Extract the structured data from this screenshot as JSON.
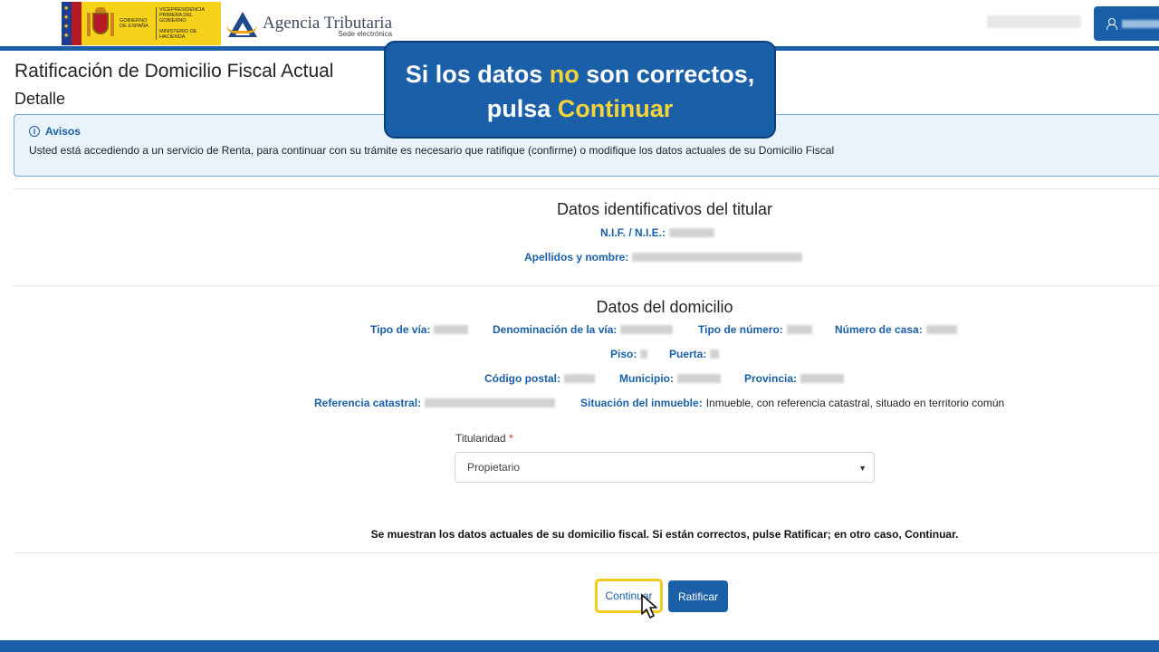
{
  "header": {
    "gov_logo": {
      "line1": "GOBIERNO DE ESPAÑA",
      "line2": "VICEPRESIDENCIA PRIMERA DEL GOBIERNO",
      "line3": "MINISTERIO DE HACIENDA"
    },
    "brand_title": "Agencia Tributaria",
    "brand_sub": "Sede electrónica"
  },
  "page": {
    "title": "Ratificación de Domicilio Fiscal Actual",
    "subtitle": "Detalle"
  },
  "alert": {
    "icon": "info-icon",
    "title": "Avisos",
    "text": "Usted está accediendo a un servicio de Renta, para continuar con su trámite es necesario que ratifique (confirme) o modifique los datos actuales de su Domicilio Fiscal"
  },
  "titular": {
    "section_title": "Datos identificativos del titular",
    "nif_label": "N.I.F. / N.I.E.:",
    "nombre_label": "Apellidos y nombre:"
  },
  "domicilio": {
    "section_title": "Datos del domicilio",
    "tipo_via_label": "Tipo de vía:",
    "denominacion_label": "Denominación de la vía:",
    "tipo_numero_label": "Tipo de número:",
    "numero_casa_label": "Número de casa:",
    "piso_label": "Piso:",
    "puerta_label": "Puerta:",
    "cp_label": "Código postal:",
    "municipio_label": "Municipio:",
    "provincia_label": "Provincia:",
    "ref_catastral_label": "Referencia catastral:",
    "situacion_label": "Situación del inmueble:",
    "situacion_value": "Inmueble, con referencia catastral, situado en territorio común"
  },
  "form": {
    "titularidad_label": "Titularidad",
    "required_mark": "*",
    "titularidad_value": "Propietario"
  },
  "note": "Se muestran los datos actuales de su domicilio fiscal. Si están correctos, pulse Ratificar; en otro caso, Continuar.",
  "buttons": {
    "continuar": "Continuar",
    "ratificar": "Ratificar"
  },
  "callout": {
    "part1": "Si los datos ",
    "highlight1": "no",
    "part2": " son correctos,",
    "part3": "pulsa ",
    "highlight2": "Continuar"
  },
  "colors": {
    "primary": "#1a5fa8",
    "highlight": "#f5d43b",
    "button_focus_border": "#f2cc1b"
  }
}
